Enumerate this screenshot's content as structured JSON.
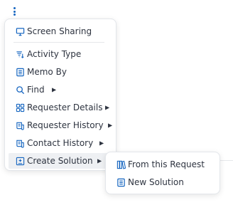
{
  "trigger": {
    "icon": "more-vertical-icon"
  },
  "menu": {
    "items": [
      {
        "label": "Screen Sharing",
        "icon": "monitor-icon",
        "has_submenu": false
      },
      {
        "label": "Activity Type",
        "icon": "filter-list-icon",
        "has_submenu": false
      },
      {
        "label": "Memo By",
        "icon": "memo-icon",
        "has_submenu": false
      },
      {
        "label": "Find",
        "icon": "search-icon",
        "has_submenu": true
      },
      {
        "label": "Requester Details",
        "icon": "grid-icon",
        "has_submenu": true
      },
      {
        "label": "Requester History",
        "icon": "history-icon",
        "has_submenu": true
      },
      {
        "label": "Contact History",
        "icon": "history-icon",
        "has_submenu": true
      },
      {
        "label": "Create Solution",
        "icon": "solution-add-icon",
        "has_submenu": true,
        "active": true
      }
    ]
  },
  "submenu": {
    "items": [
      {
        "label": "From this Request",
        "icon": "books-icon"
      },
      {
        "label": "New Solution",
        "icon": "document-icon"
      }
    ]
  },
  "colors": {
    "accent": "#1565c0",
    "text": "#2e3440",
    "active_bg": "#eef0f3",
    "border": "#e3e6ea"
  }
}
